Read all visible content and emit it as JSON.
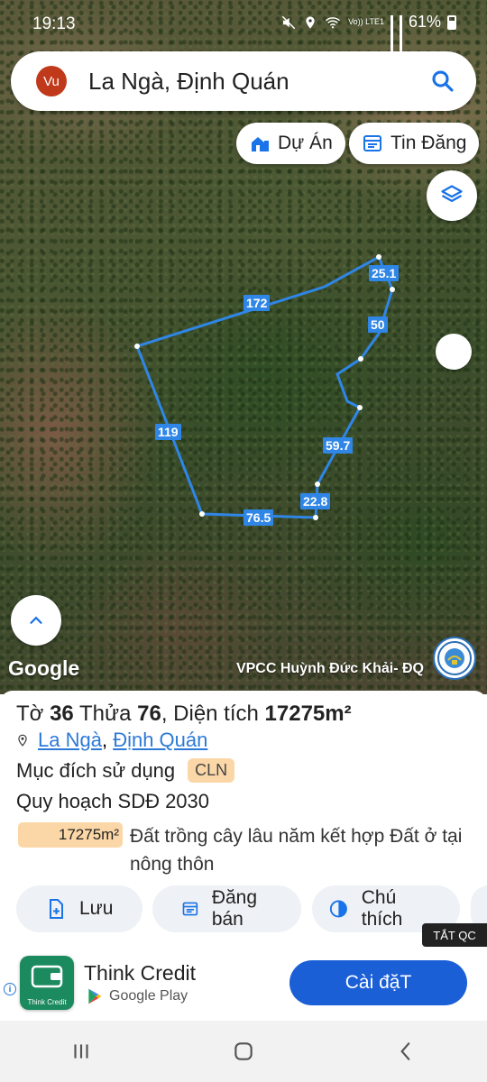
{
  "status_bar": {
    "time": "19:13",
    "network_label": "Vo)) LTE1",
    "battery_percent": "61%"
  },
  "search": {
    "avatar_initials": "Vu",
    "query": "La Ngà, Định Quán"
  },
  "chips": {
    "du_an": "Dự Án",
    "tin_dang": "Tin Đăng"
  },
  "map": {
    "edge_labels": [
      "172",
      "25.1",
      "50",
      "119",
      "59.7",
      "22.8",
      "76.5"
    ],
    "google_logo": "Google",
    "watermark": "VPCC Huỳnh Đức Khải- ĐQ",
    "accent": "#2f86e6"
  },
  "parcel": {
    "to_label": "Tờ",
    "to_value": "36",
    "thua_label": "Thửa",
    "thua_value": "76",
    "dien_tich_label": ", Diện tích",
    "dien_tich_value": "17275m²",
    "commune": "La Ngà",
    "separator": ",",
    "district": "Định Quán",
    "purpose_label": "Mục đích sử dụng",
    "purpose_code": "CLN",
    "plan_label": "Quy hoạch SDĐ 2030",
    "area_badge": "17275m²",
    "area_description": "Đất trồng cây lâu năm kết hợp Đất ở tại nông thôn"
  },
  "actions": {
    "save": "Lưu",
    "post_sale": "Đăng bán",
    "legend": "Chú thích"
  },
  "ad": {
    "close_tag": "TẮT QC",
    "app_icon_label": "Think Credit",
    "title": "Think Credit",
    "store": "Google Play",
    "install_label": "Cài đặT",
    "info_icon": "i"
  }
}
